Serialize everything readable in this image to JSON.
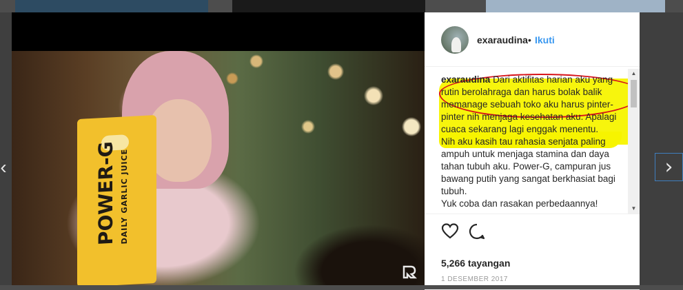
{
  "post": {
    "username": "exaraudina",
    "separator": "•",
    "follow_label": "Ikuti",
    "caption_user": "exaraudina",
    "caption_lines": [
      "Dari aktifitas harian aku yang",
      "rutin berolahraga dan harus bolak balik",
      "memanage sebuah toko aku harus pinter-",
      "pinter nih menjaga kesehatan aku. Apalagi",
      "cuaca sekarang lagi enggak menentu.",
      "Nih aku kasih tau rahasia senjata paling",
      "ampuh untuk menjaga stamina dan daya",
      "tahan tubuh aku. Power-G, campuran jus",
      "bawang putih yang sangat berkhasiat bagi",
      "tubuh.",
      "Yuk coba dan rasakan perbedaannya!"
    ],
    "views": "5,266 tayangan",
    "date": "1 DESEMBER 2017"
  },
  "media": {
    "product_name": "POWER-G",
    "product_tagline": "DAILY GARLIC JUICE"
  },
  "nav": {
    "prev_glyph": "‹",
    "next_glyph": "›"
  },
  "scrollbar": {
    "up_glyph": "▲",
    "down_glyph": "▼"
  },
  "colors": {
    "follow": "#3897f0",
    "highlight": "#f7f400",
    "annotation": "#d8141a"
  },
  "icons": [
    "heart-icon",
    "comment-icon",
    "chevron-left-icon",
    "chevron-right-icon"
  ]
}
